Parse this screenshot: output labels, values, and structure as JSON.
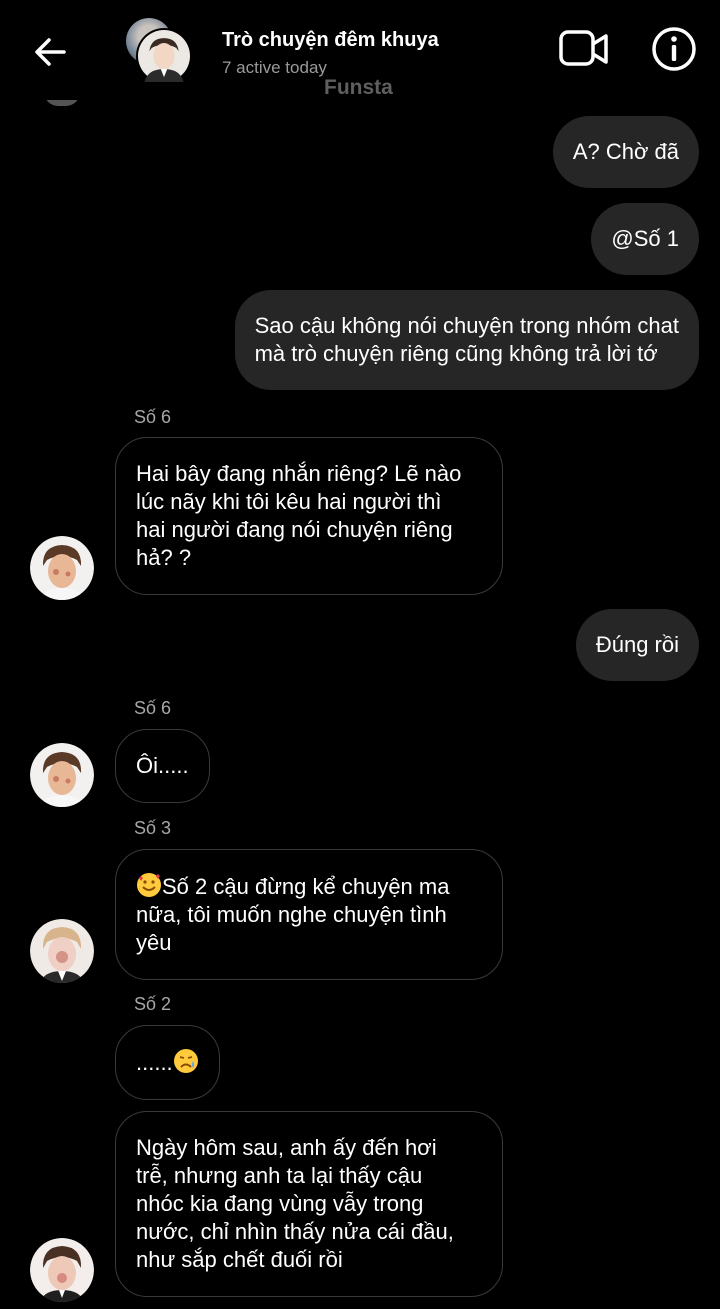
{
  "header": {
    "title": "Trò chuyện đêm khuya",
    "subtitle": "7 active today",
    "watermark": "Funsta"
  },
  "messages": [
    {
      "type": "outgoing",
      "text": "A? Chờ đã"
    },
    {
      "type": "outgoing",
      "text": "@Số 1"
    },
    {
      "type": "outgoing",
      "lines": [
        "Sao cậu không nói chuyện trong nhóm chat",
        "mà trò chuyện riêng cũng không trả lời tớ"
      ]
    },
    {
      "type": "incoming",
      "sender": "Số 6",
      "lines": [
        "Hai bây đang nhắn riêng? Lẽ nào",
        "lúc nãy khi tôi kêu hai người thì",
        "hai người đang nói chuyện riêng",
        "hả? ?"
      ]
    },
    {
      "type": "outgoing",
      "text": "Đúng rồi"
    },
    {
      "type": "incoming",
      "sender": "Số 6",
      "text": "Ôi....."
    },
    {
      "type": "incoming",
      "sender": "Số 3",
      "emoji": "smiling-face-with-hearts",
      "lines": [
        "Số 2 cậu đừng kể chuyện ma",
        "nữa, tôi muốn nghe chuyện tình",
        "yêu"
      ]
    },
    {
      "type": "incoming",
      "sender": "Số 2",
      "text": "......",
      "emoji": "crying-face"
    },
    {
      "type": "incoming",
      "lines": [
        "Ngày hôm sau, anh ấy đến hơi",
        "trễ, nhưng anh ta lại thấy cậu",
        "nhóc kia đang vùng vẫy trong",
        "nước, chỉ nhìn thấy nửa cái đầu,",
        "như sắp chết đuối rồi"
      ]
    }
  ],
  "icons": [
    "back-arrow-icon",
    "video-call-icon",
    "info-icon"
  ],
  "colors": {
    "background": "#000000",
    "outgoing_bubble": "#262626",
    "incoming_border": "#3a3a3a",
    "muted_text": "#a8a8a8"
  }
}
